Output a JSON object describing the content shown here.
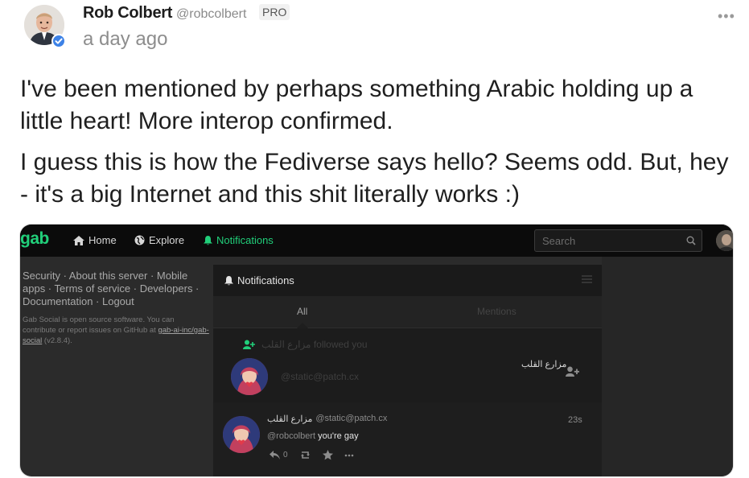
{
  "post": {
    "author_name": "Rob Colbert",
    "author_handle": "@robcolbert",
    "badge": "PRO",
    "timestamp": "a day ago",
    "more_label": "•••",
    "paragraphs": [
      "I've been mentioned by perhaps something Arabic holding up a little heart! More interop confirmed.",
      "I guess this is how the Fediverse says hello? Seems odd. But, hey - it's a big Internet and this shit literally works :)"
    ]
  },
  "embed": {
    "logo": "gab",
    "nav": {
      "home": "Home",
      "explore": "Explore",
      "notifications": "Notifications"
    },
    "search_placeholder": "Search",
    "footer_links": "Security · About this server · Mobile apps · Terms of service · Developers · Documentation · Logout",
    "footer_small_prefix": "Gab Social is open source software. You can contribute or report issues on GitHub at ",
    "footer_small_link": "gab-ai-inc/gab-social",
    "footer_small_version": " (v2.8.4).",
    "column_title": "Notifications",
    "tabs": {
      "all": "All",
      "mentions": "Mentions"
    },
    "follow_notice": "مزارع القلب followed you",
    "follow_handle": "@static@patch.cx",
    "follow_display_name": "مزارع القلب",
    "mention": {
      "display_name": "مزارع القلب",
      "handle": "@static@patch.cx",
      "time": "23s",
      "mention_handle": "@robcolbert",
      "text": "you're gay",
      "reply_count": "0"
    }
  },
  "colors": {
    "gab_green": "#21cf7a",
    "verified_blue": "#3d82e6",
    "dark_bg": "#2b2b2b"
  }
}
